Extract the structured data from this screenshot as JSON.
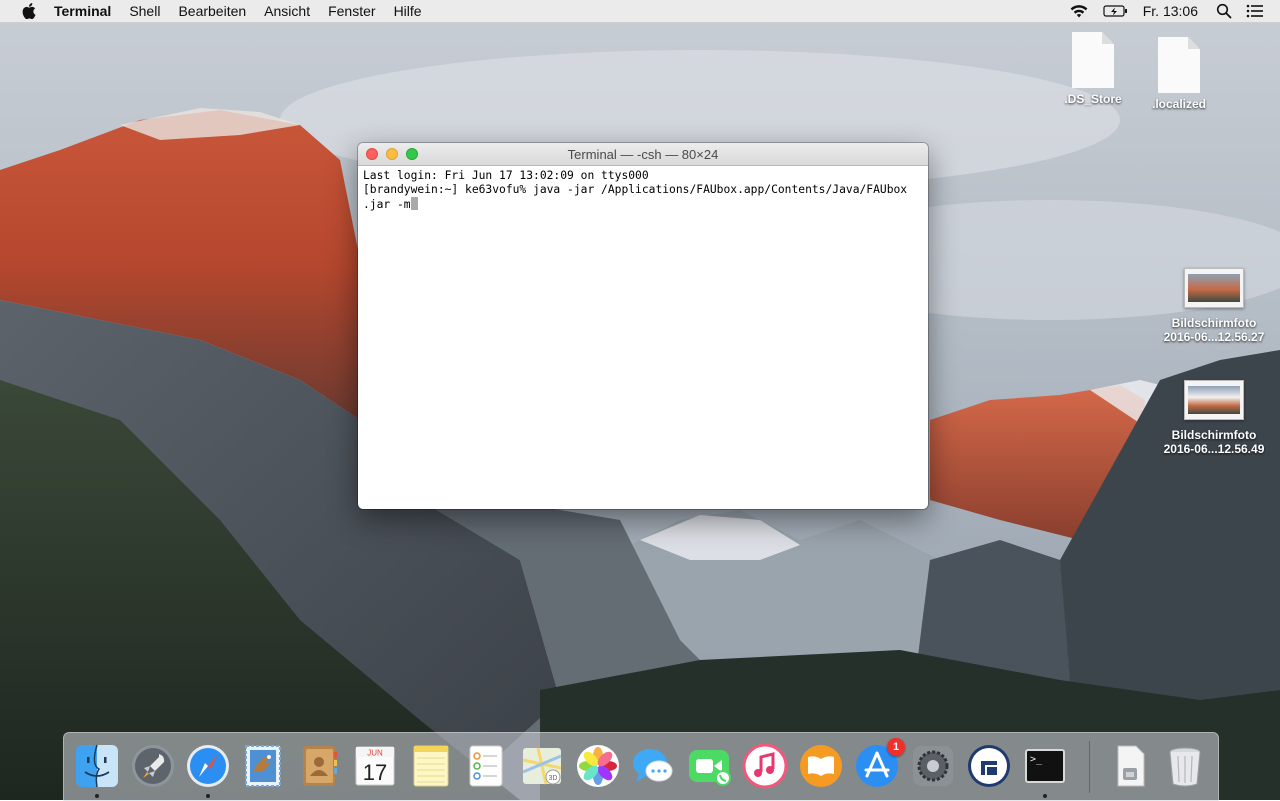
{
  "menubar": {
    "apple_icon": "apple-icon",
    "app_name": "Terminal",
    "menus": [
      "Shell",
      "Bearbeiten",
      "Ansicht",
      "Fenster",
      "Hilfe"
    ],
    "status_icons": [
      "wifi-icon",
      "battery-charging-icon"
    ],
    "clock": "Fr. 13:06",
    "spotlight_icon": "spotlight-icon",
    "notification_icon": "notification-center-icon"
  },
  "desktop_icons": [
    {
      "label": ".DS_Store",
      "kind": "file"
    },
    {
      "label": ".localized",
      "kind": "file"
    },
    {
      "label_line1": "Bildschirmfoto",
      "label_line2": "2016-06...12.56.27",
      "kind": "screenshot"
    },
    {
      "label_line1": "Bildschirmfoto",
      "label_line2": "2016-06...12.56.49",
      "kind": "screenshot"
    }
  ],
  "terminal": {
    "title": "Terminal — -csh — 80×24",
    "lines": [
      "Last login: Fri Jun 17 13:02:09 on ttys000",
      "[brandywein:~] ke63vofu% java -jar /Applications/FAUbox.app/Contents/Java/FAUbox",
      ".jar -m"
    ]
  },
  "dock": {
    "items": [
      {
        "name": "finder-icon",
        "running": true
      },
      {
        "name": "launchpad-icon",
        "running": false
      },
      {
        "name": "safari-icon",
        "running": true
      },
      {
        "name": "mail-icon",
        "running": false
      },
      {
        "name": "contacts-icon",
        "running": false
      },
      {
        "name": "calendar-icon",
        "running": false,
        "month": "JUN",
        "day": "17"
      },
      {
        "name": "notes-icon",
        "running": false
      },
      {
        "name": "reminders-icon",
        "running": false
      },
      {
        "name": "maps-icon",
        "running": false
      },
      {
        "name": "photos-icon",
        "running": false
      },
      {
        "name": "messages-icon",
        "running": false
      },
      {
        "name": "facetime-icon",
        "running": false
      },
      {
        "name": "itunes-icon",
        "running": false
      },
      {
        "name": "ibooks-icon",
        "running": false
      },
      {
        "name": "app-store-icon",
        "running": false,
        "badge": "1"
      },
      {
        "name": "system-preferences-icon",
        "running": false
      },
      {
        "name": "faubox-icon",
        "running": false
      },
      {
        "name": "terminal-icon",
        "running": true
      },
      {
        "name": "downloads-stack-icon",
        "running": false
      },
      {
        "name": "trash-icon",
        "running": false
      }
    ]
  },
  "colors": {
    "menubar_bg": "#ececec",
    "close": "#fc605c",
    "minimize": "#fdbc40",
    "maximize": "#34c84a",
    "badge": "#f1302b"
  }
}
